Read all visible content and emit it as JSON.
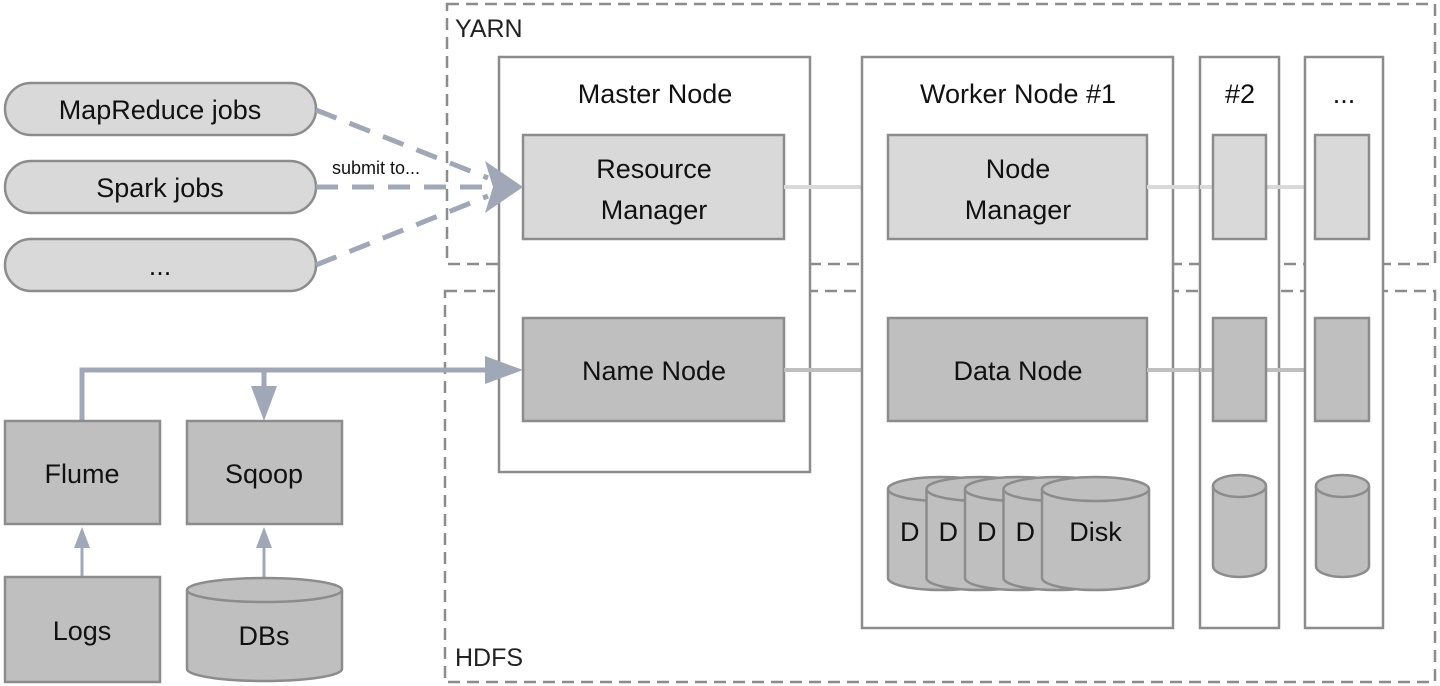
{
  "colors": {
    "light_box": "#d9d9d9",
    "dark_box": "#bfbfbf",
    "border": "#8c8c8c",
    "arrow": "#a0a8b8",
    "dashed": "#8c8c8c"
  },
  "regions": {
    "yarn": "YARN",
    "hdfs": "HDFS"
  },
  "jobs": {
    "items": [
      "MapReduce jobs",
      "Spark jobs",
      "..."
    ],
    "edge_label": "submit to..."
  },
  "master": {
    "title": "Master Node",
    "resource_manager_1": "Resource",
    "resource_manager_2": "Manager",
    "name_node": "Name Node"
  },
  "worker1": {
    "title": "Worker Node #1",
    "node_manager_1": "Node",
    "node_manager_2": "Manager",
    "data_node": "Data Node",
    "disk_label": "Disk",
    "disk_partial": "D"
  },
  "worker2": {
    "title": "#2"
  },
  "worker_more": {
    "title": "..."
  },
  "ingest": {
    "flume": "Flume",
    "sqoop": "Sqoop",
    "logs": "Logs",
    "dbs": "DBs"
  }
}
